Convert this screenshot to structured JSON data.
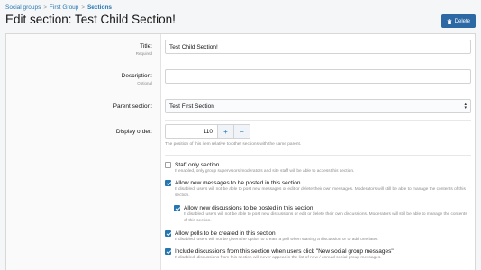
{
  "breadcrumb": {
    "items": [
      "Social groups",
      "First Group",
      "Sections"
    ],
    "separator": ">"
  },
  "page": {
    "title": "Edit section: Test Child Section!",
    "delete_label": "Delete"
  },
  "form": {
    "title": {
      "label": "Title:",
      "hint": "Required",
      "value": "Test Child Section!"
    },
    "description": {
      "label": "Description:",
      "hint": "Optional",
      "value": ""
    },
    "parent_section": {
      "label": "Parent section:",
      "value": "Test First Section"
    },
    "display_order": {
      "label": "Display order:",
      "value": "110",
      "plus": "+",
      "minus": "−",
      "explain": "The position of this item relative to other sections with the same parent."
    },
    "options": [
      {
        "checked": false,
        "title": "Staff only section",
        "desc": "If enabled, only group supervisors/moderators and site staff will be able to access this section."
      },
      {
        "checked": true,
        "title": "Allow new messages to be posted in this section",
        "desc": "If disabled, users will not be able to post new messages or edit or delete their own messages. Moderators will still be able to manage the contents of this section."
      },
      {
        "checked": true,
        "title": "Allow new discussions to be posted in this section",
        "desc": "If disabled, users will not be able to post new discussions or edit or delete their own discussions. Moderators will still be able to manage the contents of this section."
      },
      {
        "checked": true,
        "title": "Allow polls to be created in this section",
        "desc": "If disabled, users will not be given the option to create a poll when starting a discussion or to add one later."
      },
      {
        "checked": true,
        "title": "Include discussions from this section when users click \"New social group messages\"",
        "desc": "If disabled, discussions from this section will never appear in the list of new / unread social group messages."
      }
    ]
  },
  "colors": {
    "accent": "#2577b1",
    "button": "#2b68a4",
    "background": "#f5f6f8"
  }
}
